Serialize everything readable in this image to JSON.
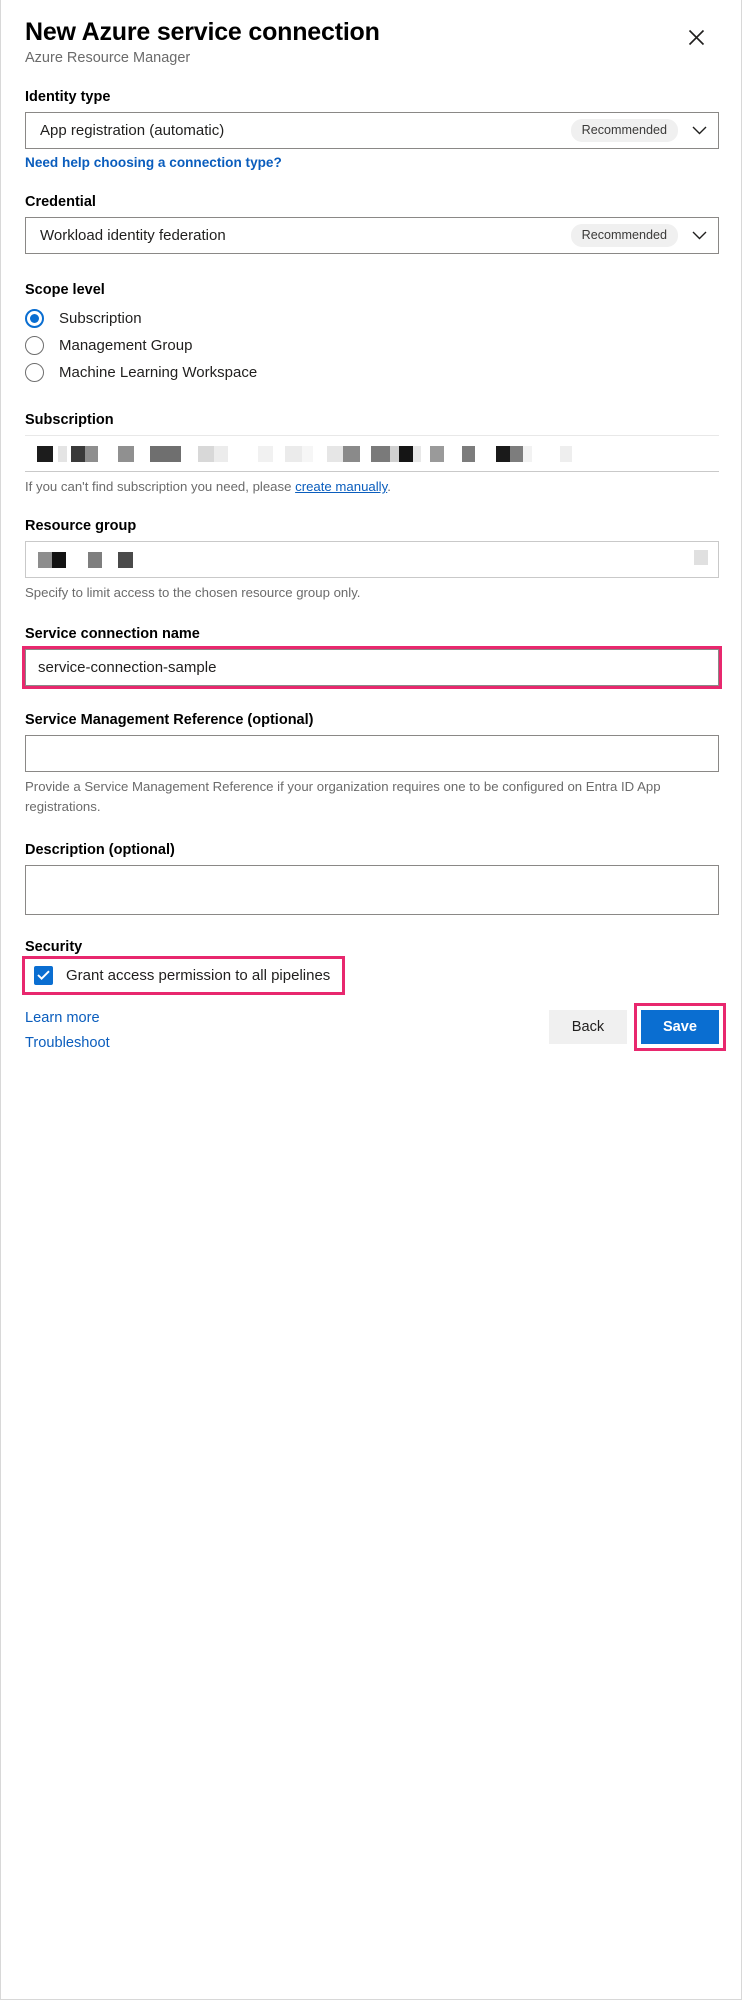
{
  "dialog": {
    "title": "New Azure service connection",
    "subtitle": "Azure Resource Manager",
    "close_icon": "close-icon"
  },
  "identity_type": {
    "label": "Identity type",
    "value": "App registration (automatic)",
    "badge": "Recommended",
    "help_link": "Need help choosing a connection type?"
  },
  "credential": {
    "label": "Credential",
    "value": "Workload identity federation",
    "badge": "Recommended"
  },
  "scope_level": {
    "label": "Scope level",
    "options": [
      {
        "label": "Subscription",
        "checked": true
      },
      {
        "label": "Management Group",
        "checked": false
      },
      {
        "label": "Machine Learning Workspace",
        "checked": false
      }
    ]
  },
  "subscription": {
    "label": "Subscription",
    "value": "",
    "redacted": true,
    "helper_prefix": "If you can't find subscription you need, please ",
    "helper_link": "create manually",
    "helper_suffix": "."
  },
  "resource_group": {
    "label": "Resource group",
    "value": "",
    "redacted": true,
    "helper": "Specify to limit access to the chosen resource group only."
  },
  "service_connection_name": {
    "label": "Service connection name",
    "value": "service-connection-sample",
    "placeholder": "",
    "highlighted": true
  },
  "service_management_reference": {
    "label": "Service Management Reference (optional)",
    "value": "",
    "placeholder": "",
    "helper": "Provide a Service Management Reference if your organization requires one to be configured on Entra ID App registrations."
  },
  "description": {
    "label": "Description (optional)",
    "value": "",
    "placeholder": ""
  },
  "security": {
    "label": "Security",
    "checkbox_label": "Grant access permission to all pipelines",
    "checked": true,
    "highlighted": true
  },
  "footer": {
    "learn_more": "Learn more",
    "troubleshoot": "Troubleshoot",
    "back_label": "Back",
    "save_label": "Save",
    "save_highlighted": true
  },
  "colors": {
    "accent_blue": "#0a6ed1",
    "link_blue": "#0a5dbd",
    "highlight_pink": "#e8286e",
    "badge_bg": "#f0f0f0",
    "border_gray": "#8a8886",
    "muted_text": "#6b6b6b"
  }
}
